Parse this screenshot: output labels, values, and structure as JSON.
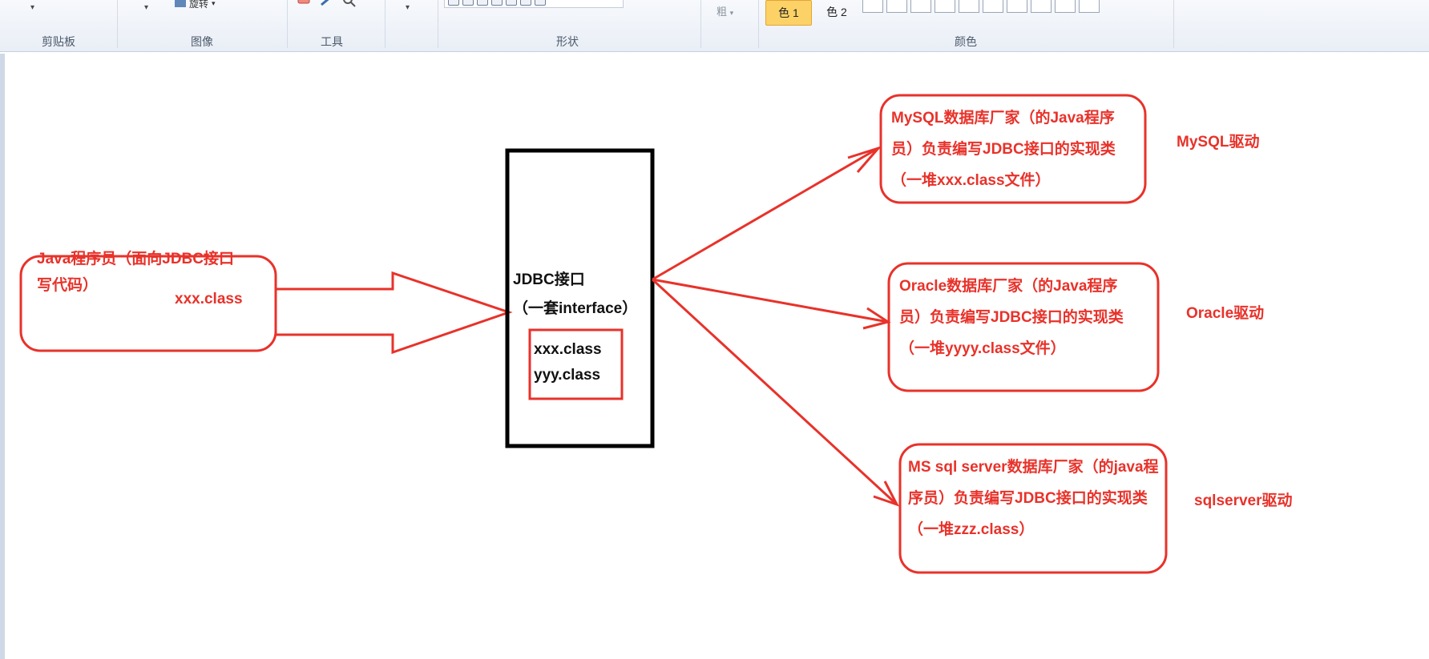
{
  "ribbon": {
    "groups": {
      "clipboard": "剪贴板",
      "image": "图像",
      "tools": "工具",
      "shapes": "形状",
      "colors": "颜色"
    },
    "rotate_label": "旋转",
    "size_label": "粗",
    "color1_label": "色 1",
    "color2_label": "色 2",
    "accent_color": "#fcd267"
  },
  "diagram": {
    "programmer_box": {
      "text": "Java程序员（面向JDBC接口写代码）",
      "file": "xxx.class"
    },
    "jdbc_box": {
      "title": "JDBC接口",
      "subtitle": "（一套interface）",
      "files": [
        "xxx.class",
        "yyy.class"
      ]
    },
    "vendors": [
      {
        "text": "MySQL数据库厂家（的Java程序员）负责编写JDBC接口的实现类 （一堆xxx.class文件）",
        "driver_label": "MySQL驱动"
      },
      {
        "text": "Oracle数据库厂家（的Java程序员）负责编写JDBC接口的实现类（一堆yyyy.class文件）",
        "driver_label": "Oracle驱动"
      },
      {
        "text": "MS sql server数据库厂家（的java程序员）负责编写JDBC接口的实现类（一堆zzz.class）",
        "driver_label": "sqlserver驱动"
      }
    ],
    "stroke_color": "#e8322a",
    "box_border_color": "#000000"
  }
}
